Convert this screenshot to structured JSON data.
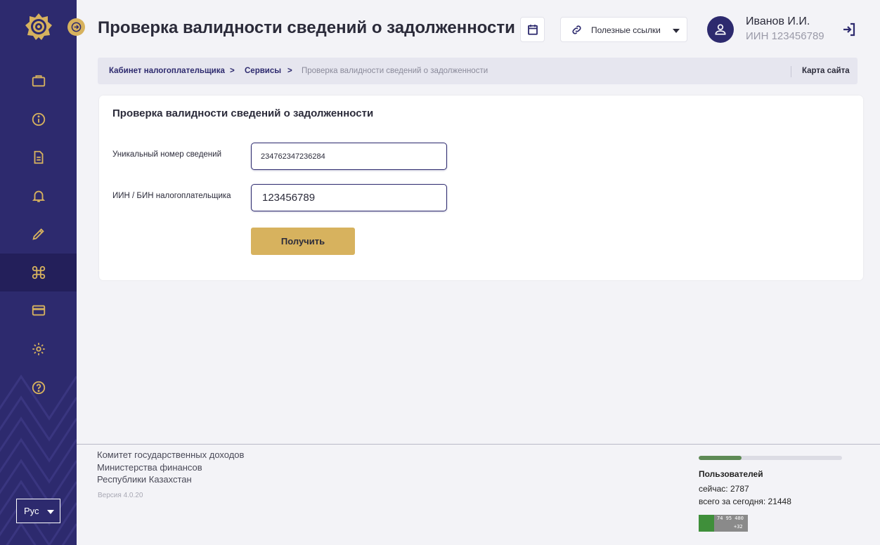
{
  "header": {
    "title": "Проверка валидности сведений о задолженности",
    "links_label": "Полезные ссылки",
    "user_name": "Иванов И.И.",
    "user_iin": "ИИН 123456789"
  },
  "breadcrumb": {
    "items": [
      "Кабинет налогоплательщика",
      "Сервисы",
      "Проверка валидности сведений о задолженности"
    ],
    "separator": ">",
    "sitemap": "Карта сайта"
  },
  "form": {
    "title": "Проверка валидности сведений о задолженности",
    "unique_number_label": "Уникальный номер сведений",
    "unique_number_value": "234762347236284",
    "iin_label": "ИИН / БИН налогоплательщика",
    "iin_value": "123456789",
    "submit_label": "Получить"
  },
  "sidebar": {
    "items": [
      {
        "icon": "briefcase-icon"
      },
      {
        "icon": "info-icon"
      },
      {
        "icon": "document-icon"
      },
      {
        "icon": "bell-icon"
      },
      {
        "icon": "pencil-icon"
      },
      {
        "icon": "command-icon",
        "active": true
      },
      {
        "icon": "card-icon"
      },
      {
        "icon": "gear-icon"
      },
      {
        "icon": "help-icon"
      }
    ],
    "language": "Рус"
  },
  "footer": {
    "org_line1": "Комитет государственных доходов",
    "org_line2": "Министерства финансов",
    "org_line3": "Республики Казахстан",
    "version": "Версия 4.0.20",
    "users_title": "Пользователей",
    "users_now": "сейчас: 2787",
    "users_today": "всего за сегодня: 21448",
    "users_bar_fraction": 0.3,
    "counter_line1": "74 95 480",
    "counter_line2": "+32"
  },
  "colors": {
    "sidebar": "#2d2a6e",
    "accent_gold": "#d7b25e",
    "background": "#f3f3f7"
  }
}
